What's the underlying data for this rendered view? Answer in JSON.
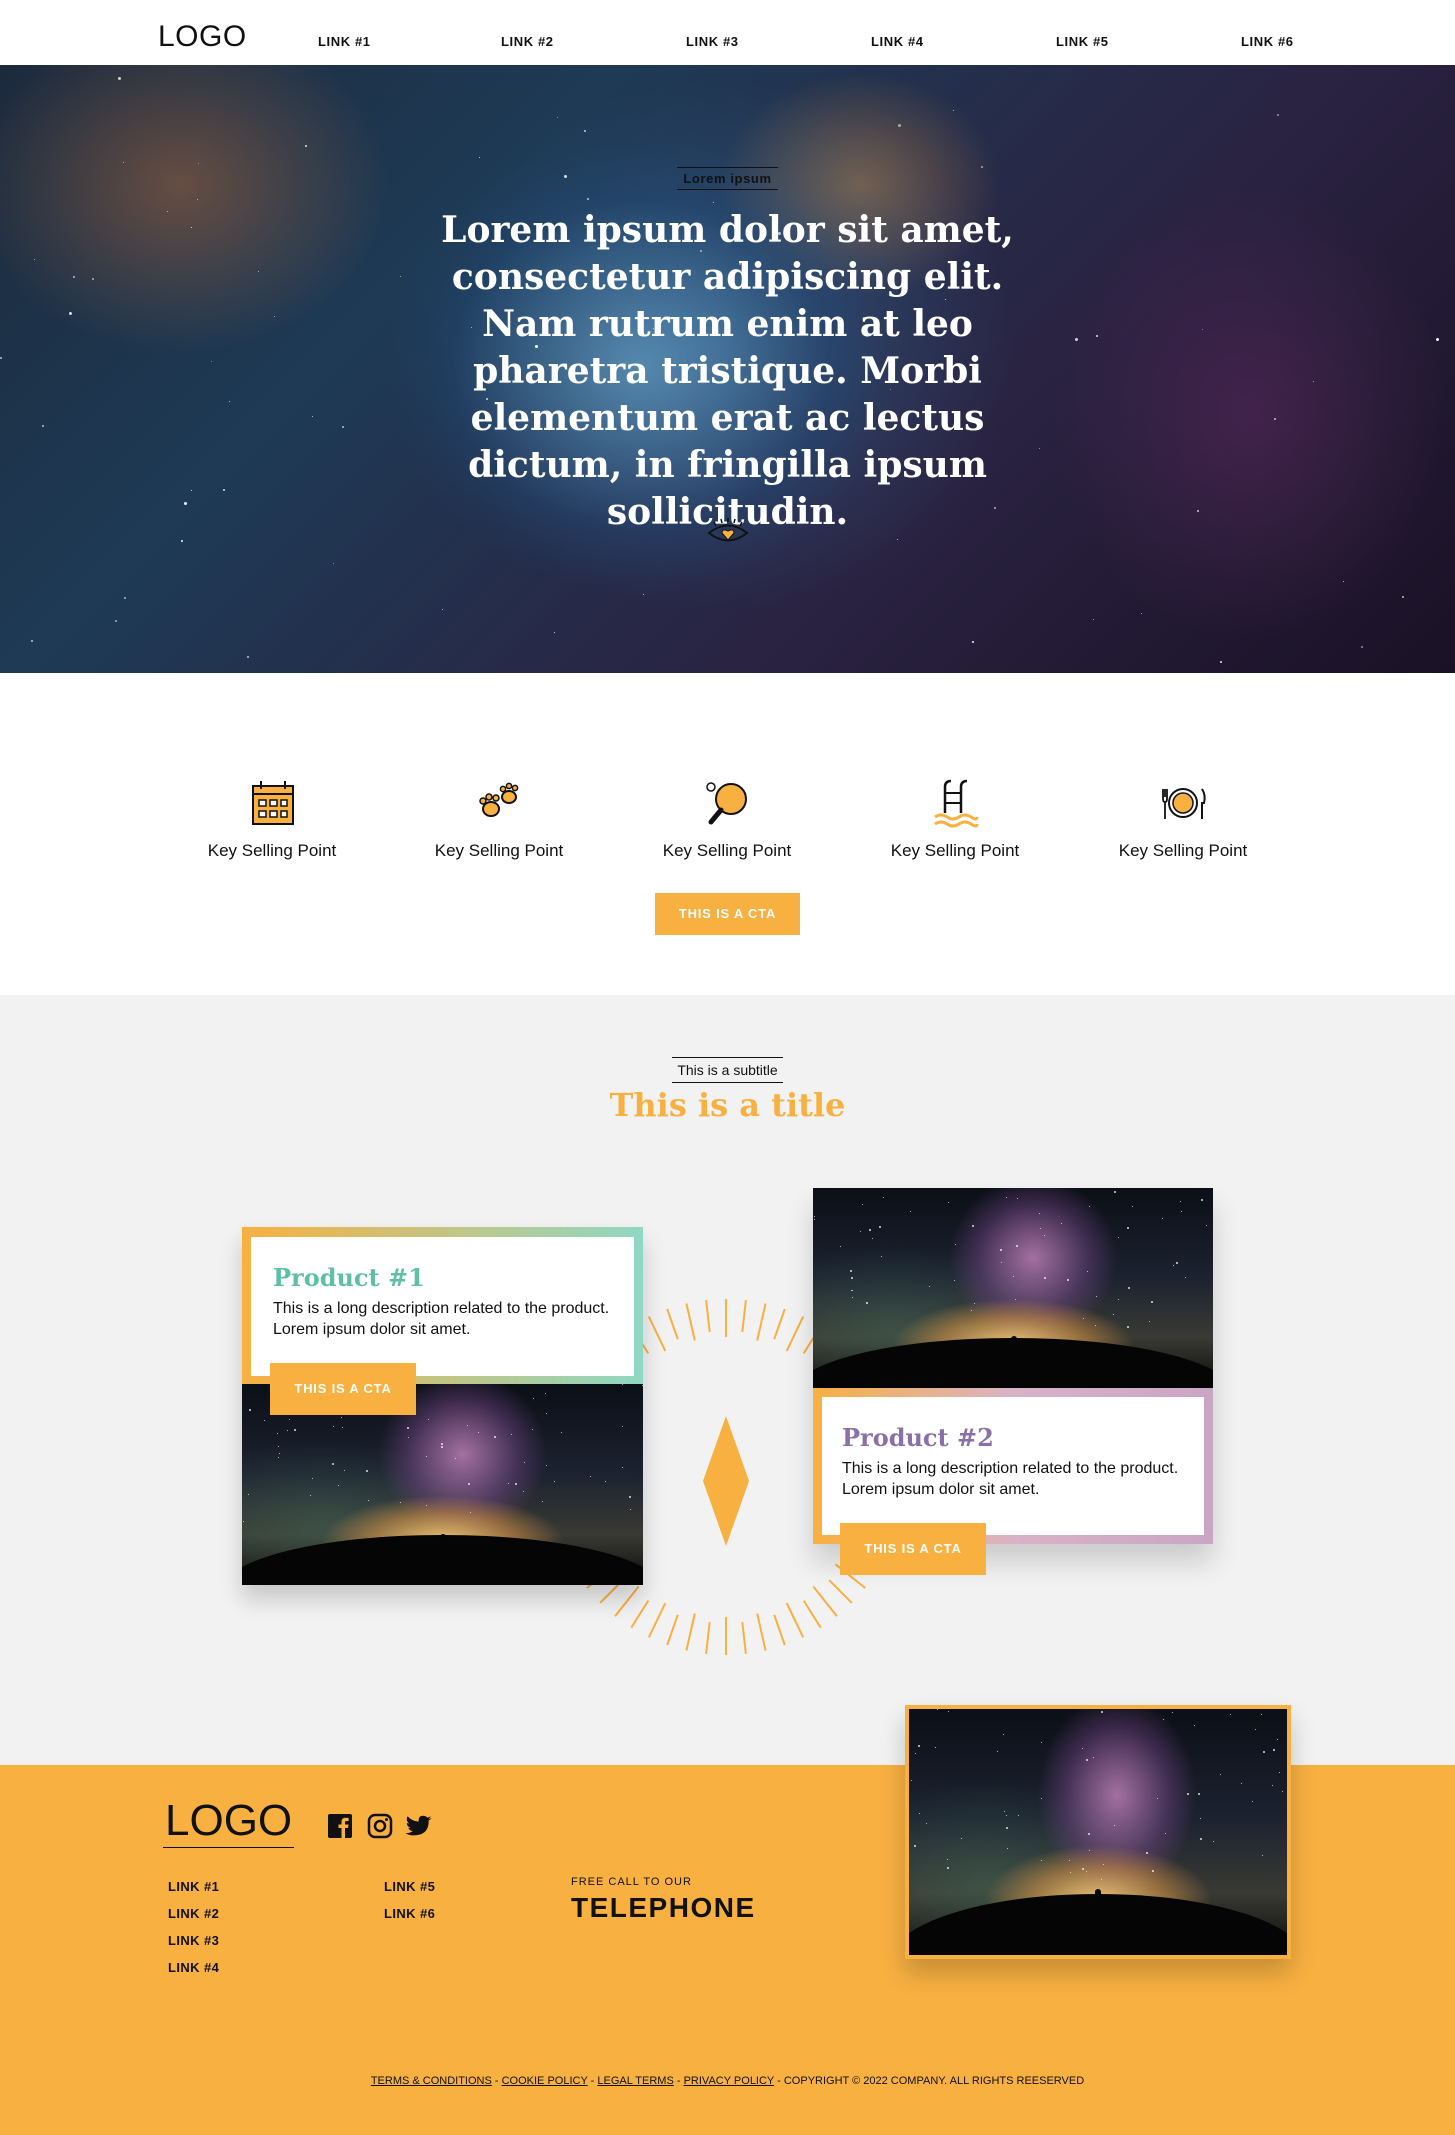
{
  "nav": {
    "logo": "LOGO",
    "links": [
      "LINK #1",
      "LINK #2",
      "LINK #3",
      "LINK #4",
      "LINK #5",
      "LINK #6"
    ]
  },
  "hero": {
    "kicker": "Lorem ipsum",
    "headline": "Lorem ipsum dolor sit amet, consectetur adipiscing elit. Nam rutrum enim at leo pharetra tristique. Morbi elementum erat ac lectus dictum, in fringilla ipsum sollicitudin."
  },
  "selling_points": [
    {
      "icon": "calendar-icon",
      "label": "Key Selling Point"
    },
    {
      "icon": "paw-prints-icon",
      "label": "Key Selling Point"
    },
    {
      "icon": "ping-pong-icon",
      "label": "Key Selling Point"
    },
    {
      "icon": "pool-ladder-icon",
      "label": "Key Selling Point"
    },
    {
      "icon": "plate-cutlery-icon",
      "label": "Key Selling Point"
    }
  ],
  "main_cta": "THIS IS A CTA",
  "section": {
    "subtitle": "This is a subtitle",
    "title": "This is a title"
  },
  "products": [
    {
      "name": "Product #1",
      "description": "This is a long description related to the product. Lorem ipsum dolor sit amet.",
      "cta": "THIS IS A CTA"
    },
    {
      "name": "Product #2",
      "description": "This is a long description related to the product. Lorem ipsum dolor sit amet.",
      "cta": "THIS IS A CTA"
    }
  ],
  "footer": {
    "logo": "LOGO",
    "social": [
      "facebook-icon",
      "instagram-icon",
      "twitter-icon"
    ],
    "links_col1": [
      "LINK #1",
      "LINK #2",
      "LINK #3",
      "LINK #4"
    ],
    "links_col2": [
      "LINK #5",
      "LINK #6"
    ],
    "call_label": "FREE CALL TO OUR",
    "telephone": "TELEPHONE",
    "legal": {
      "terms": "TERMS & CONDITIONS",
      "cookie": "COOKIE POLICY",
      "legal_terms": "LEGAL TERMS",
      "privacy": "PRIVACY POLICY",
      "sep": " - ",
      "copyright": "COPYRIGHT © 2022 COMPANY. ALL RIGHTS REESERVED"
    }
  },
  "colors": {
    "accent": "#f8b041",
    "product1": "#5dbfa6",
    "product2": "#8b6fa8",
    "grey_bg": "#f2f2f2"
  }
}
